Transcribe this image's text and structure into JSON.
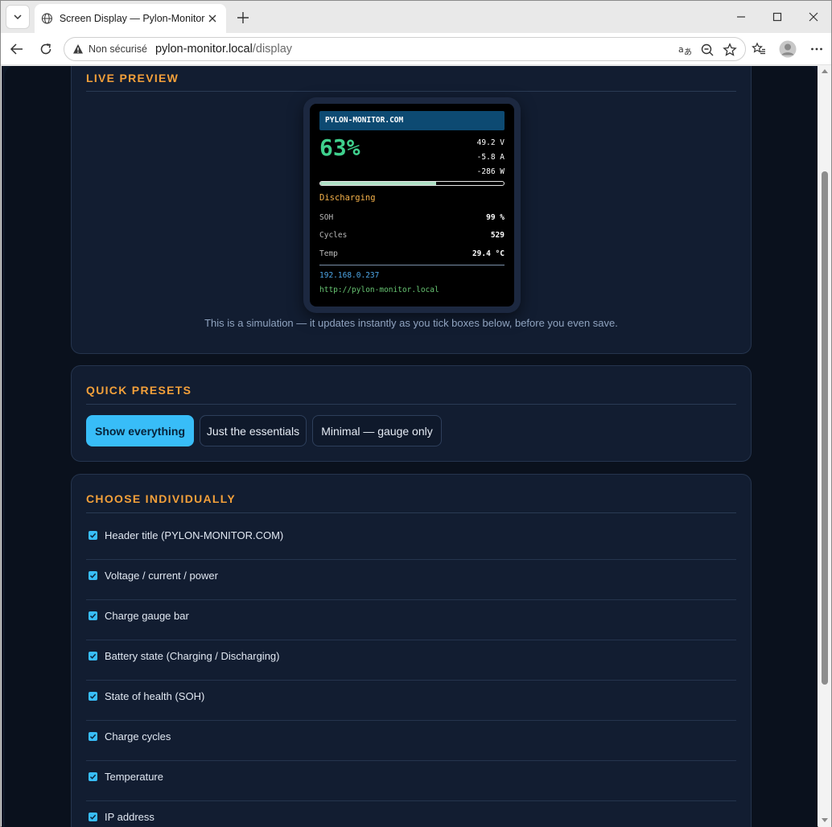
{
  "browser": {
    "tab_title": "Screen Display — Pylon-Monitor",
    "security_label": "Non sécurisé",
    "url_host": "pylon-monitor.local",
    "url_path": "/display"
  },
  "preview": {
    "title": "LIVE PREVIEW",
    "screen": {
      "header": "PYLON-MONITOR.COM",
      "percent": "63%",
      "percent_value": 63,
      "voltage": "49.2 V",
      "current": "-5.8 A",
      "power": "-286 W",
      "state": "Discharging",
      "soh_label": "SOH",
      "soh_value": "99 %",
      "cycles_label": "Cycles",
      "cycles_value": "529",
      "temp_label": "Temp",
      "temp_value": "29.4 °C",
      "ip": "192.168.0.237",
      "url": "http://pylon-monitor.local"
    },
    "note": "This is a simulation — it updates instantly as you tick boxes below, before you even save."
  },
  "presets": {
    "title": "QUICK PRESETS",
    "buttons": [
      "Show everything",
      "Just the essentials",
      "Minimal — gauge only"
    ]
  },
  "choose": {
    "title": "CHOOSE INDIVIDUALLY",
    "options": [
      {
        "label": "Header title (PYLON-MONITOR.COM)",
        "checked": true
      },
      {
        "label": "Voltage / current / power",
        "checked": true
      },
      {
        "label": "Charge gauge bar",
        "checked": true
      },
      {
        "label": "Battery state (Charging / Discharging)",
        "checked": true
      },
      {
        "label": "State of health (SOH)",
        "checked": true
      },
      {
        "label": "Charge cycles",
        "checked": true
      },
      {
        "label": "Temperature",
        "checked": true
      },
      {
        "label": "IP address",
        "checked": true
      }
    ]
  },
  "colors": {
    "accent": "#38bdf8",
    "section_title": "#f3a03a",
    "gauge_pct_text": "#3fd08d",
    "state_text": "#f3b04a"
  }
}
